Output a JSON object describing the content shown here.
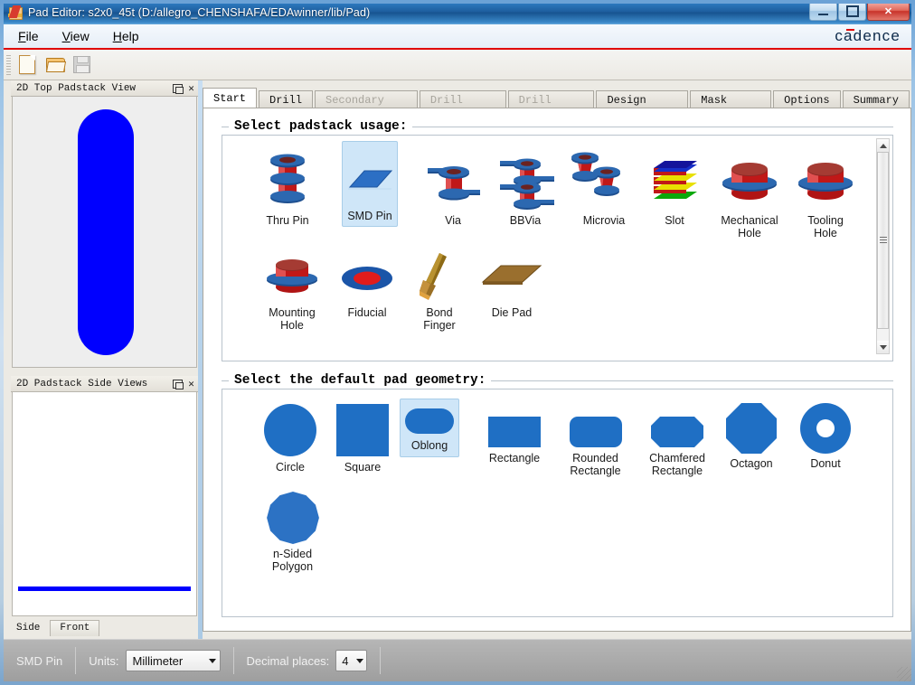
{
  "window": {
    "title": "Pad Editor: s2x0_45t  (D:/allegro_CHENSHAFA/EDAwinner/lib/Pad)",
    "minimize_label": "Minimize",
    "maximize_label": "Maximize",
    "close_label": "✕",
    "brand": "cadence"
  },
  "menu": [
    {
      "label": "File",
      "accel": "F"
    },
    {
      "label": "View",
      "accel": "V"
    },
    {
      "label": "Help",
      "accel": "H"
    }
  ],
  "toolbar": [
    {
      "name": "new-icon",
      "tooltip": "New"
    },
    {
      "name": "open-icon",
      "tooltip": "Open"
    },
    {
      "name": "save-icon",
      "tooltip": "Save",
      "disabled": true
    }
  ],
  "panels": {
    "top_view": {
      "title": "2D Top Padstack View",
      "float_label": "Float",
      "close_label": "✕",
      "shape": "oblong",
      "shape_color": "#0000ff"
    },
    "side_view": {
      "title": "2D Padstack Side Views",
      "float_label": "Float",
      "close_label": "✕",
      "line_color": "#0000ff",
      "tabs": [
        {
          "label": "Side",
          "active": true
        },
        {
          "label": "Front",
          "active": false
        }
      ]
    }
  },
  "tabs": [
    {
      "label": "Start",
      "state": "active"
    },
    {
      "label": "Drill",
      "state": "enabled"
    },
    {
      "label": "Secondary Drill",
      "state": "disabled"
    },
    {
      "label": "Drill Symbol",
      "state": "disabled"
    },
    {
      "label": "Drill Offset",
      "state": "disabled"
    },
    {
      "label": "Design Layers",
      "state": "enabled"
    },
    {
      "label": "Mask Layers",
      "state": "enabled"
    },
    {
      "label": "Options",
      "state": "enabled"
    },
    {
      "label": "Summary",
      "state": "enabled"
    }
  ],
  "padstack_usage": {
    "legend": "Select padstack usage:",
    "selected": "SMD Pin",
    "items": [
      {
        "label": "Thru Pin",
        "icon": "thru-pin-icon",
        "selected": false
      },
      {
        "label": "SMD Pin",
        "icon": "smd-pin-icon",
        "selected": true
      },
      {
        "label": "Via",
        "icon": "via-icon",
        "selected": false
      },
      {
        "label": "BBVia",
        "icon": "bbvia-icon",
        "selected": false
      },
      {
        "label": "Microvia",
        "icon": "microvia-icon",
        "selected": false
      },
      {
        "label": "Slot",
        "icon": "slot-icon",
        "selected": false
      },
      {
        "label": "Mechanical\nHole",
        "icon": "mechanical-hole-icon",
        "selected": false
      },
      {
        "label": "Tooling\nHole",
        "icon": "tooling-hole-icon",
        "selected": false
      },
      {
        "label": "Mounting\nHole",
        "icon": "mounting-hole-icon",
        "selected": false
      },
      {
        "label": "Fiducial",
        "icon": "fiducial-icon",
        "selected": false
      },
      {
        "label": "Bond\nFinger",
        "icon": "bond-finger-icon",
        "selected": false
      },
      {
        "label": "Die Pad",
        "icon": "die-pad-icon",
        "selected": false
      }
    ]
  },
  "pad_geometry": {
    "legend": "Select the default pad geometry:",
    "selected": "Oblong",
    "items": [
      {
        "label": "Circle",
        "icon": "circle-shape-icon",
        "selected": false
      },
      {
        "label": "Square",
        "icon": "square-shape-icon",
        "selected": false
      },
      {
        "label": "Oblong",
        "icon": "oblong-shape-icon",
        "selected": true
      },
      {
        "label": "Rectangle",
        "icon": "rectangle-shape-icon",
        "selected": false
      },
      {
        "label": "Rounded\nRectangle",
        "icon": "rounded-rectangle-shape-icon",
        "selected": false
      },
      {
        "label": "Chamfered\nRectangle",
        "icon": "chamfered-rectangle-shape-icon",
        "selected": false
      },
      {
        "label": "Octagon",
        "icon": "octagon-shape-icon",
        "selected": false
      },
      {
        "label": "Donut",
        "icon": "donut-shape-icon",
        "selected": false
      },
      {
        "label": "n-Sided\nPolygon",
        "icon": "n-sided-polygon-shape-icon",
        "selected": false
      }
    ]
  },
  "statusbar": {
    "mode": "SMD Pin",
    "units_label": "Units:",
    "units_value": "Millimeter",
    "decimals_label": "Decimal places:",
    "decimals_value": "4"
  },
  "colors": {
    "pad_blue": "#0000ff",
    "shape_blue": "#1f6fc4",
    "accent_red": "#e00000",
    "selection_blue": "#cfe6f8"
  }
}
